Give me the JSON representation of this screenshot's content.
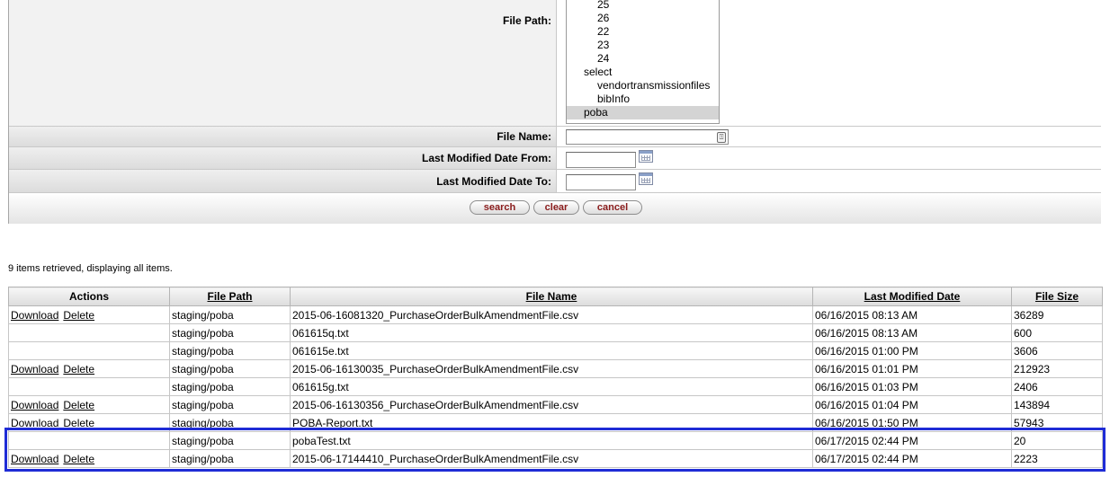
{
  "criteria": {
    "file_path_label": "File Path:",
    "file_path_options": [
      {
        "label": "25",
        "indent": 2
      },
      {
        "label": "26",
        "indent": 2
      },
      {
        "label": "22",
        "indent": 2
      },
      {
        "label": "23",
        "indent": 2
      },
      {
        "label": "24",
        "indent": 2
      },
      {
        "label": "select",
        "indent": 1
      },
      {
        "label": "vendortransmissionfiles",
        "indent": 2
      },
      {
        "label": "bibInfo",
        "indent": 2
      },
      {
        "label": "poba",
        "indent": 1,
        "selected": true
      }
    ],
    "file_name_label": "File Name:",
    "file_name_value": "",
    "from_label": "Last Modified Date From:",
    "from_value": "",
    "to_label": "Last Modified Date To:",
    "to_value": "",
    "buttons": {
      "search": "search",
      "clear": "clear",
      "cancel": "cancel"
    }
  },
  "results": {
    "summary": "9 items retrieved, displaying all items.",
    "columns": [
      "Actions",
      "File Path",
      "File Name",
      "Last Modified Date",
      "File Size"
    ],
    "action_labels": {
      "download": "Download",
      "delete": "Delete"
    },
    "rows": [
      {
        "actions": true,
        "path": "staging/poba",
        "name": "2015-06-16081320_PurchaseOrderBulkAmendmentFile.csv",
        "date": "06/16/2015 08:13 AM",
        "size": "36289"
      },
      {
        "actions": false,
        "path": "staging/poba",
        "name": "061615q.txt",
        "date": "06/16/2015 08:13 AM",
        "size": "600"
      },
      {
        "actions": false,
        "path": "staging/poba",
        "name": "061615e.txt",
        "date": "06/16/2015 01:00 PM",
        "size": "3606"
      },
      {
        "actions": true,
        "path": "staging/poba",
        "name": "2015-06-16130035_PurchaseOrderBulkAmendmentFile.csv",
        "date": "06/16/2015 01:01 PM",
        "size": "212923"
      },
      {
        "actions": false,
        "path": "staging/poba",
        "name": "061615g.txt",
        "date": "06/16/2015 01:03 PM",
        "size": "2406"
      },
      {
        "actions": true,
        "path": "staging/poba",
        "name": "2015-06-16130356_PurchaseOrderBulkAmendmentFile.csv",
        "date": "06/16/2015 01:04 PM",
        "size": "143894"
      },
      {
        "actions": true,
        "path": "staging/poba",
        "name": "POBA-Report.txt",
        "date": "06/16/2015 01:50 PM",
        "size": "57943"
      },
      {
        "actions": false,
        "path": "staging/poba",
        "name": "pobaTest.txt",
        "date": "06/17/2015 02:44 PM",
        "size": "20"
      },
      {
        "actions": true,
        "path": "staging/poba",
        "name": "2015-06-17144410_PurchaseOrderBulkAmendmentFile.csv",
        "date": "06/17/2015 02:44 PM",
        "size": "2223"
      }
    ]
  },
  "colors": {
    "highlight": "#1f2cd6",
    "button_text": "#8a1c1c"
  }
}
